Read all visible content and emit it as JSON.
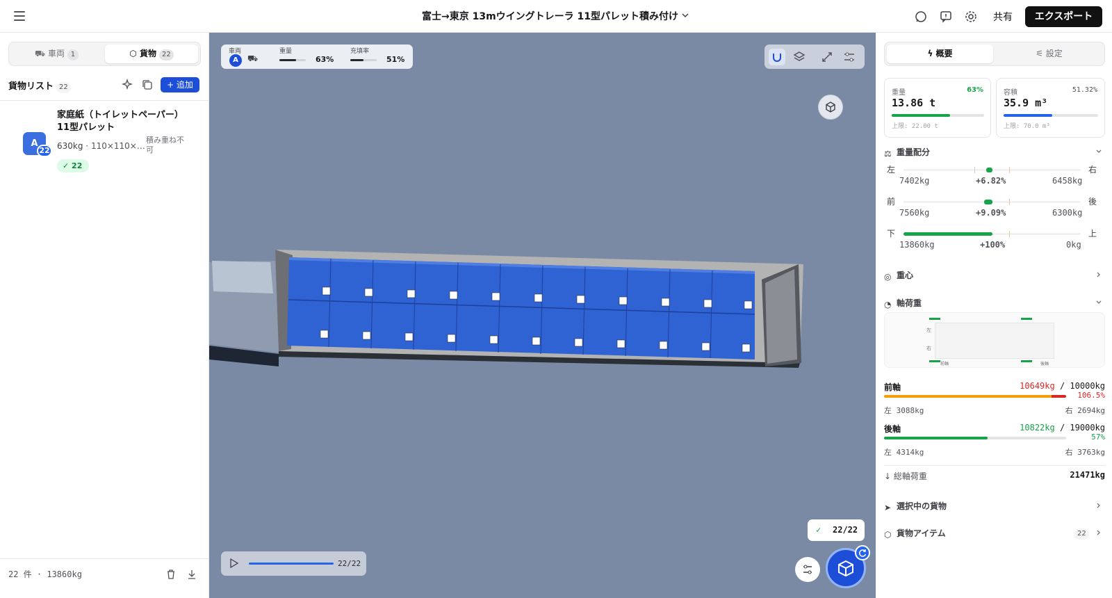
{
  "header": {
    "title": "富士→東京 13mウイングトレーラ 11型パレット積み付け",
    "share_label": "共有",
    "export_label": "エクスポート"
  },
  "left": {
    "tabs": [
      {
        "label": "車両",
        "count": "1"
      },
      {
        "label": "貨物",
        "count": "22"
      }
    ],
    "list_title": "貨物リスト",
    "list_count": "22",
    "add_label": "+ 追加",
    "item": {
      "avatar": "A",
      "badge": "22",
      "name": "家庭紙（トイレットペーパー）11型パレット",
      "weight": "630kg",
      "dims": "110×110×…",
      "stack": "積み重ね不可",
      "placed": "✓ 22"
    },
    "footer": "22 件 · 13860kg"
  },
  "viewport": {
    "vehicle_label": "車両",
    "vehicle_badge": "A",
    "weight_label": "重量",
    "weight_pct": "63%",
    "weight_frac": 0.63,
    "fill_label": "充填率",
    "fill_pct": "51%",
    "fill_frac": 0.51,
    "playback": "22/22",
    "done_count": "22/22"
  },
  "right": {
    "tabs": [
      {
        "label": "概要"
      },
      {
        "label": "設定"
      }
    ],
    "weight_card": {
      "label": "重量",
      "pct": "63%",
      "value": "13.86 t",
      "limit": "上限: 22.00 t",
      "frac": 0.63
    },
    "volume_card": {
      "label": "容積",
      "pct": "51.32%",
      "value": "35.9 m³",
      "limit": "上限: 70.0 m³",
      "frac": 0.5132
    },
    "distribution": {
      "title": "重量配分",
      "rows": [
        {
          "left": "左",
          "right": "右",
          "lval": "7402kg",
          "diff": "+6.82%",
          "rval": "6458kg"
        },
        {
          "left": "前",
          "right": "後",
          "lval": "7560kg",
          "diff": "+9.09%",
          "rval": "6300kg"
        },
        {
          "left": "下",
          "right": "上",
          "lval": "13860kg",
          "diff": "+100%",
          "rval": "0kg"
        }
      ]
    },
    "cog_title": "重心",
    "axle_title": "軸荷重",
    "diagram": {
      "left": "左",
      "right": "右",
      "front": "前軸",
      "rear": "後軸"
    },
    "front_axle": {
      "label": "前軸",
      "load": "10649kg",
      "limit": "10000kg",
      "pct": "106.5%",
      "left": "左 3088kg",
      "right": "右 2694kg",
      "frac": 1.065
    },
    "rear_axle": {
      "label": "後軸",
      "load": "10822kg",
      "limit": "19000kg",
      "pct": "57%",
      "left": "左 4314kg",
      "right": "右 3763kg",
      "frac": 0.57
    },
    "total_label": "総軸荷重",
    "total_value": "21471kg",
    "selected_title": "選択中の貨物",
    "items_title": "貨物アイテム",
    "items_count": "22"
  },
  "colors": {
    "accent": "#1d4ed8",
    "ok": "#16a34a",
    "over": "#dc2626",
    "warn": "#f59e0b"
  }
}
